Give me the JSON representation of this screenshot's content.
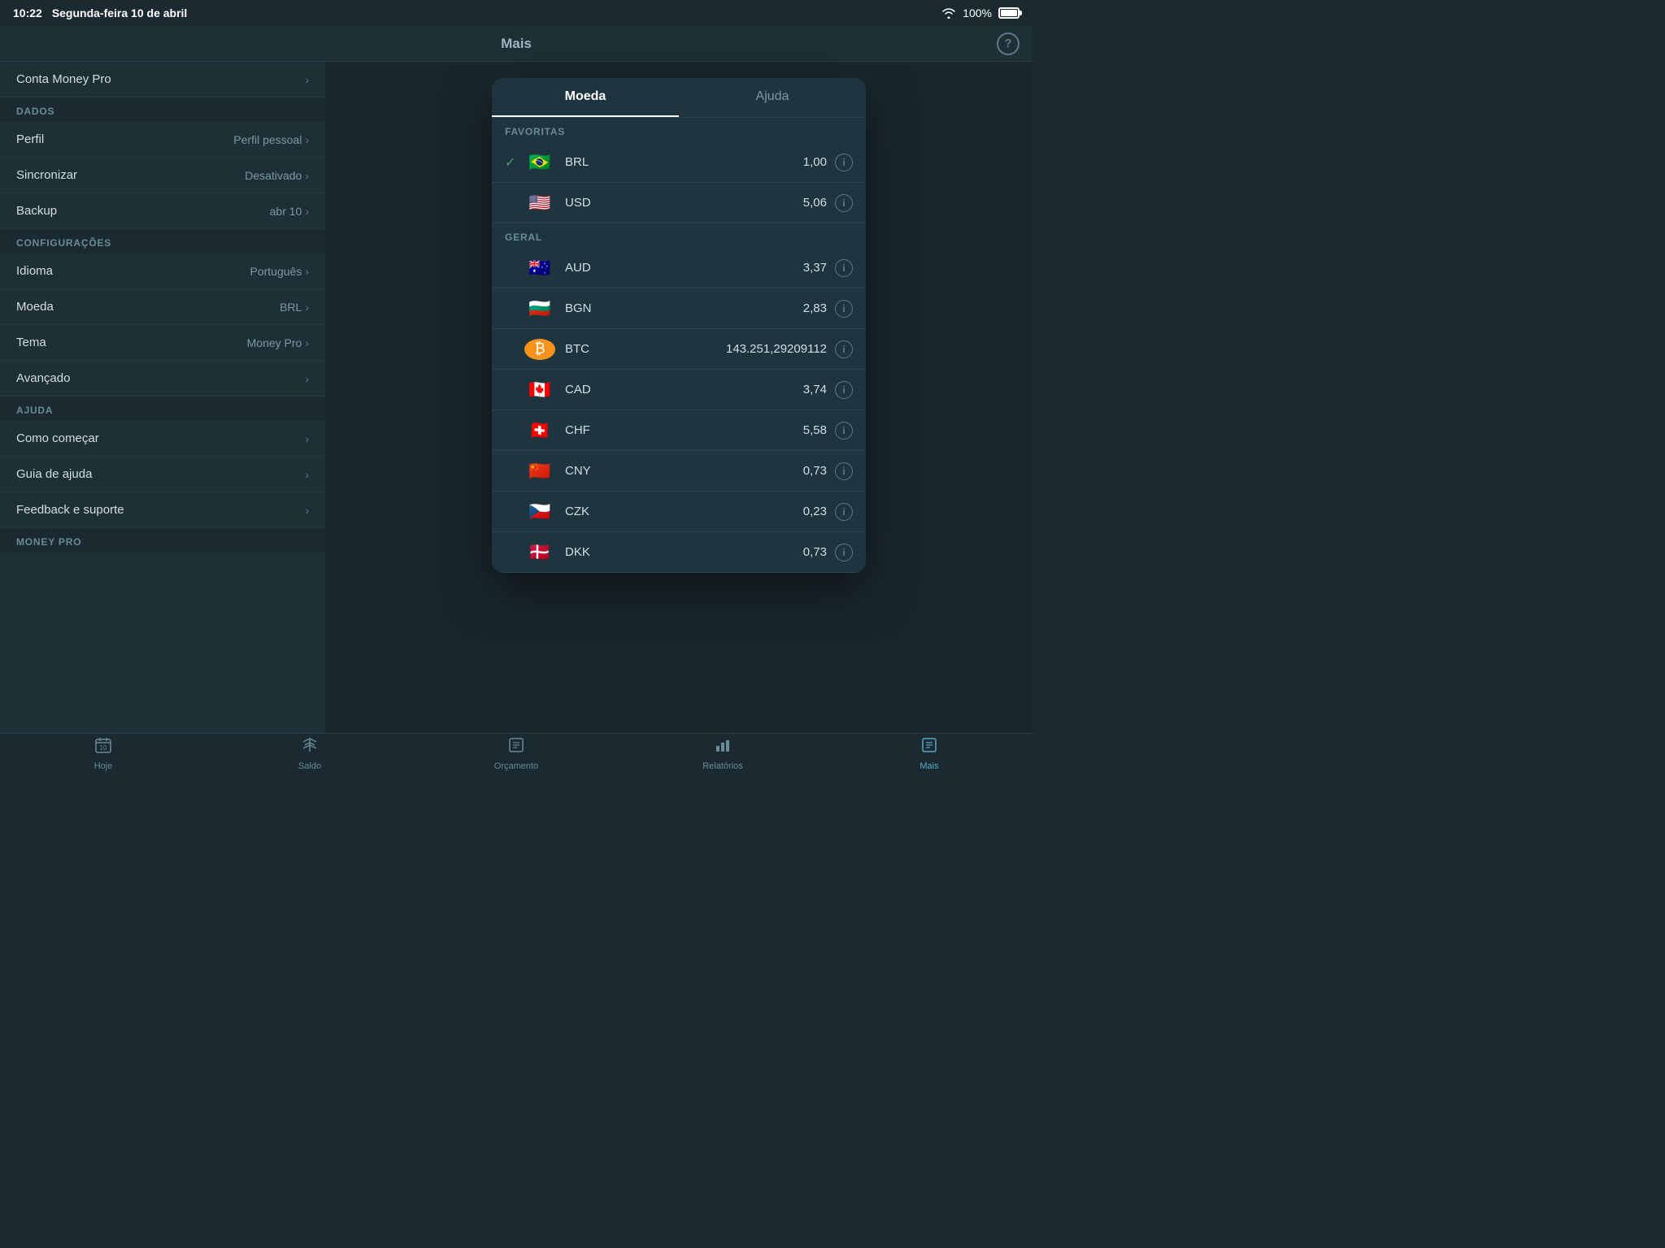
{
  "statusBar": {
    "time": "10:22",
    "date": "Segunda-feira 10 de abril",
    "wifi": "wifi",
    "battery": "100%"
  },
  "header": {
    "title": "Mais",
    "helpLabel": "?"
  },
  "leftMenu": {
    "topItem": {
      "label": "Conta Money Pro"
    },
    "sections": [
      {
        "title": "DADOS",
        "items": [
          {
            "label": "Perfil",
            "value": "Perfil pessoal"
          },
          {
            "label": "Sincronizar",
            "value": "Desativado"
          },
          {
            "label": "Backup",
            "value": "abr 10"
          }
        ]
      },
      {
        "title": "CONFIGURAÇÕES",
        "items": [
          {
            "label": "Idioma",
            "value": "Português"
          },
          {
            "label": "Moeda",
            "value": "BRL"
          },
          {
            "label": "Tema",
            "value": "Money Pro"
          },
          {
            "label": "Avançado",
            "value": ""
          }
        ]
      },
      {
        "title": "AJUDA",
        "items": [
          {
            "label": "Como começar",
            "value": ""
          },
          {
            "label": "Guia de ajuda",
            "value": ""
          },
          {
            "label": "Feedback e suporte",
            "value": ""
          }
        ]
      },
      {
        "title": "MONEY PRO",
        "items": []
      }
    ]
  },
  "modal": {
    "tabs": [
      {
        "label": "Moeda",
        "active": true
      },
      {
        "label": "Ajuda",
        "active": false
      }
    ],
    "favoritesSection": "FAVORITAS",
    "generalSection": "GERAL",
    "currencies": {
      "favorites": [
        {
          "code": "BRL",
          "value": "1,00",
          "flag": "🇧🇷",
          "selected": true
        },
        {
          "code": "USD",
          "value": "5,06",
          "flag": "🇺🇸",
          "selected": false
        }
      ],
      "general": [
        {
          "code": "AUD",
          "value": "3,37",
          "flag": "🇦🇺",
          "selected": false
        },
        {
          "code": "BGN",
          "value": "2,83",
          "flag": "🇧🇬",
          "selected": false
        },
        {
          "code": "BTC",
          "value": "143.251,29209112",
          "flag": "₿",
          "isBTC": true,
          "selected": false
        },
        {
          "code": "CAD",
          "value": "3,74",
          "flag": "🇨🇦",
          "selected": false
        },
        {
          "code": "CHF",
          "value": "5,58",
          "flag": "🇨🇭",
          "selected": false
        },
        {
          "code": "CNY",
          "value": "0,73",
          "flag": "🇨🇳",
          "selected": false
        },
        {
          "code": "CZK",
          "value": "0,23",
          "flag": "🇨🇿",
          "selected": false
        },
        {
          "code": "DKK",
          "value": "0,73",
          "flag": "🇩🇰",
          "selected": false
        }
      ]
    }
  },
  "tabBar": {
    "items": [
      {
        "label": "Hoje",
        "icon": "📅",
        "active": false
      },
      {
        "label": "Saldo",
        "icon": "⚖️",
        "active": false
      },
      {
        "label": "Orçamento",
        "icon": "📋",
        "active": false
      },
      {
        "label": "Relatórios",
        "icon": "📊",
        "active": false
      },
      {
        "label": "Mais",
        "icon": "📄",
        "active": true
      }
    ]
  }
}
